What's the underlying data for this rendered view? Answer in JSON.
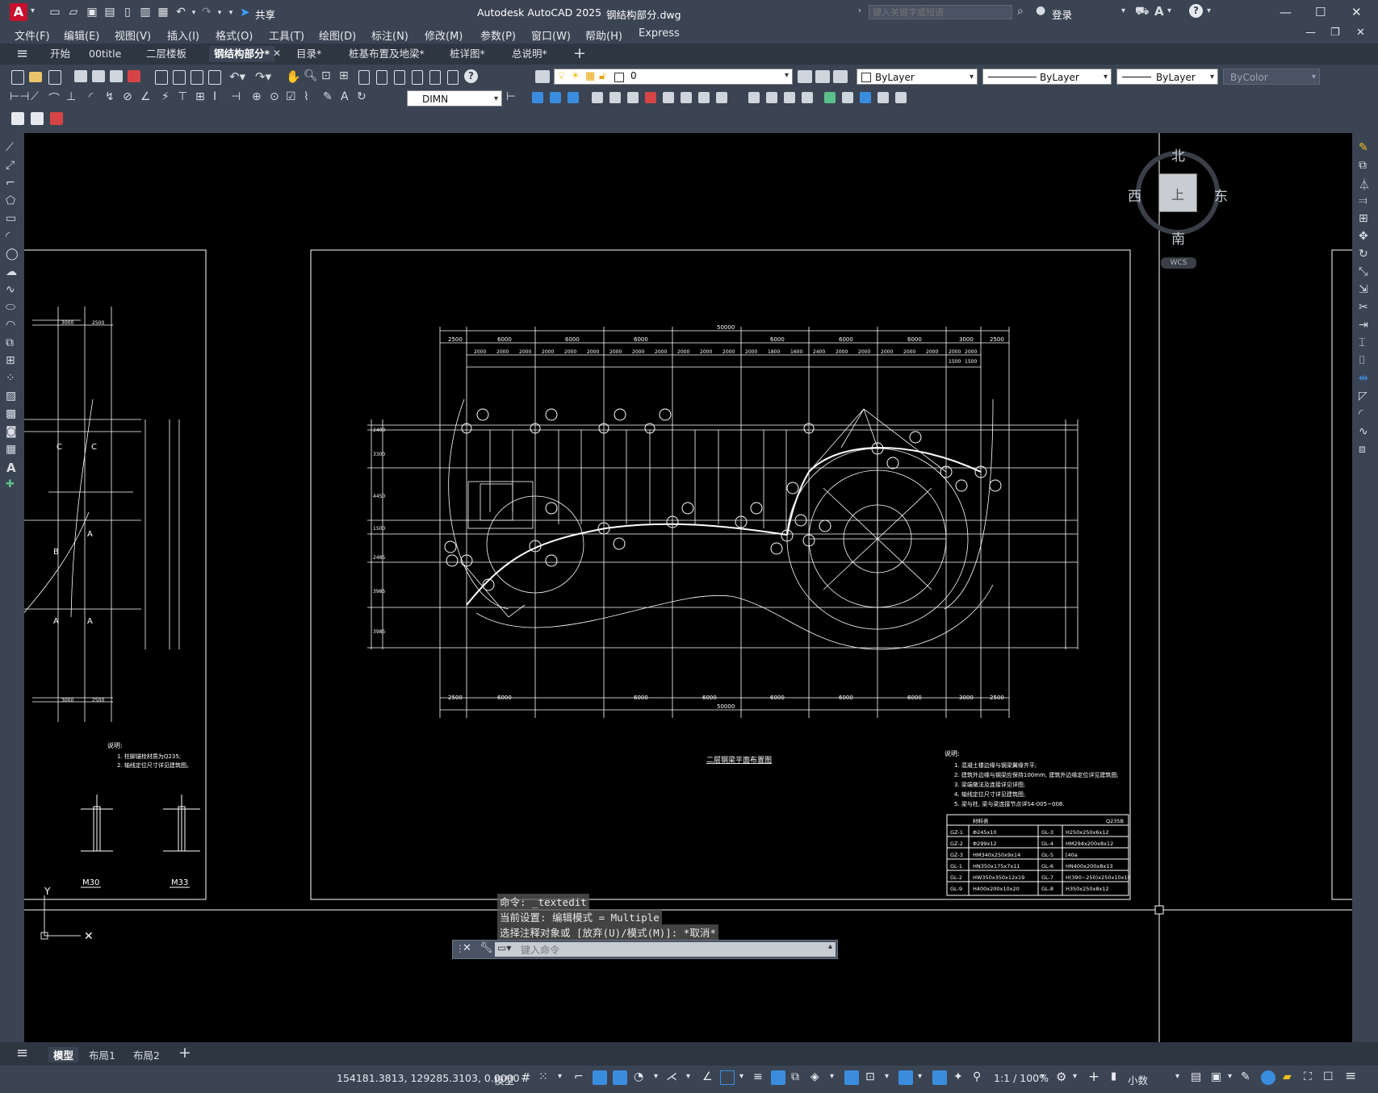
{
  "titlebar": {
    "logo": "A",
    "title": "Autodesk AutoCAD 2025",
    "filename": "钢结构部分.dwg",
    "share": "共享",
    "search_placeholder": "键入关键字或短语",
    "login": "登录"
  },
  "menu": [
    "文件(F)",
    "编辑(E)",
    "视图(V)",
    "插入(I)",
    "格式(O)",
    "工具(T)",
    "绘图(D)",
    "标注(N)",
    "修改(M)",
    "参数(P)",
    "窗口(W)",
    "帮助(H)",
    "Express"
  ],
  "tabs": [
    "开始",
    "00title",
    "二层楼板",
    "钢结构部分*",
    "目录*",
    "桩基布置及地梁*",
    "桩详图*",
    "总说明*"
  ],
  "ribbon": {
    "layer_value": "0",
    "dim_style": "DIMN",
    "color_value": "ByLayer",
    "linetype_value": "ByLayer",
    "lineweight_value": "ByLayer",
    "plotstyle_value": "ByColor"
  },
  "viewcube": {
    "north": "北",
    "south": "南",
    "east": "东",
    "west": "西",
    "face": "上",
    "wcs": "WCS"
  },
  "drawing": {
    "top_dim_total": "50000",
    "top_dims": [
      "2500",
      "6000",
      "6000",
      "6000",
      "6000",
      "6000",
      "6000",
      "3000",
      "2500"
    ],
    "sub_dims": [
      "2000",
      "2000",
      "2000",
      "2000",
      "2000",
      "2000",
      "2000",
      "2000",
      "2000",
      "2000",
      "2000",
      "2000",
      "2000",
      "1800",
      "1600",
      "2400",
      "2000",
      "2000",
      "2000",
      "2000",
      "2000",
      "2000",
      "2000",
      "1500",
      "1500"
    ],
    "left_dims": [
      "2400",
      "3300",
      "4450",
      "1500",
      "2485",
      "3985",
      "3985"
    ],
    "plan_title": "二层钢梁平面布置图",
    "notes_title": "说明:",
    "notes": [
      "1. 混凝土楼边缘与钢梁翼缘齐平;",
      "2. 建筑外边缘与钢梁应保持100mm, 建筑外边缘定位详见建筑图;",
      "3. 梁端做法及连接详见详图;",
      "4. 轴线定位尺寸详见建筑图;",
      "5. 梁与柱, 梁与梁连接节点详S4-005~008."
    ],
    "table_header": {
      "c1": "材料表",
      "c2": "Q235B"
    },
    "table_rows": [
      [
        "GZ-1",
        "Φ245x10",
        "GL-3",
        "H250x250x6x12"
      ],
      [
        "GZ-2",
        "Φ299x12",
        "GL-4",
        "HM294x200x8x12"
      ],
      [
        "GZ-3",
        "HM340x250x9x14",
        "GL-5",
        "[40a"
      ],
      [
        "GL-1",
        "HN350x175x7x11",
        "GL-6",
        "HN400x200x8x13"
      ],
      [
        "GL-2",
        "HW350x350x12x19",
        "GL-7",
        "H(390~250)x250x10x16"
      ],
      [
        "GL-9",
        "H400x200x10x20",
        "GL-8",
        "H350x250x8x12"
      ]
    ],
    "left_notes_title": "说明:",
    "left_notes": [
      "1. 柱脚锚栓材质为Q235;",
      "2. 轴线定位尺寸详见建筑图。"
    ],
    "detail_labels": [
      "M30",
      "M33"
    ],
    "left_grid_labels": [
      "C",
      "C",
      "A",
      "B",
      "A",
      "A"
    ],
    "left_dims_top": [
      "3000",
      "2500"
    ],
    "left_dims_bottom": [
      "3000",
      "2500"
    ]
  },
  "command": {
    "history": [
      "命令: _textedit",
      "当前设置: 编辑模式 = Multiple",
      "选择注释对象或 [放弃(U)/模式(M)]: *取消*"
    ],
    "placeholder": "键入命令"
  },
  "layout_tabs": [
    "模型",
    "布局1",
    "布局2"
  ],
  "status": {
    "coords": "154181.3813, 129285.3103, 0.0000",
    "model": "模型",
    "scale": "1:1 / 100%",
    "units": "小数"
  }
}
